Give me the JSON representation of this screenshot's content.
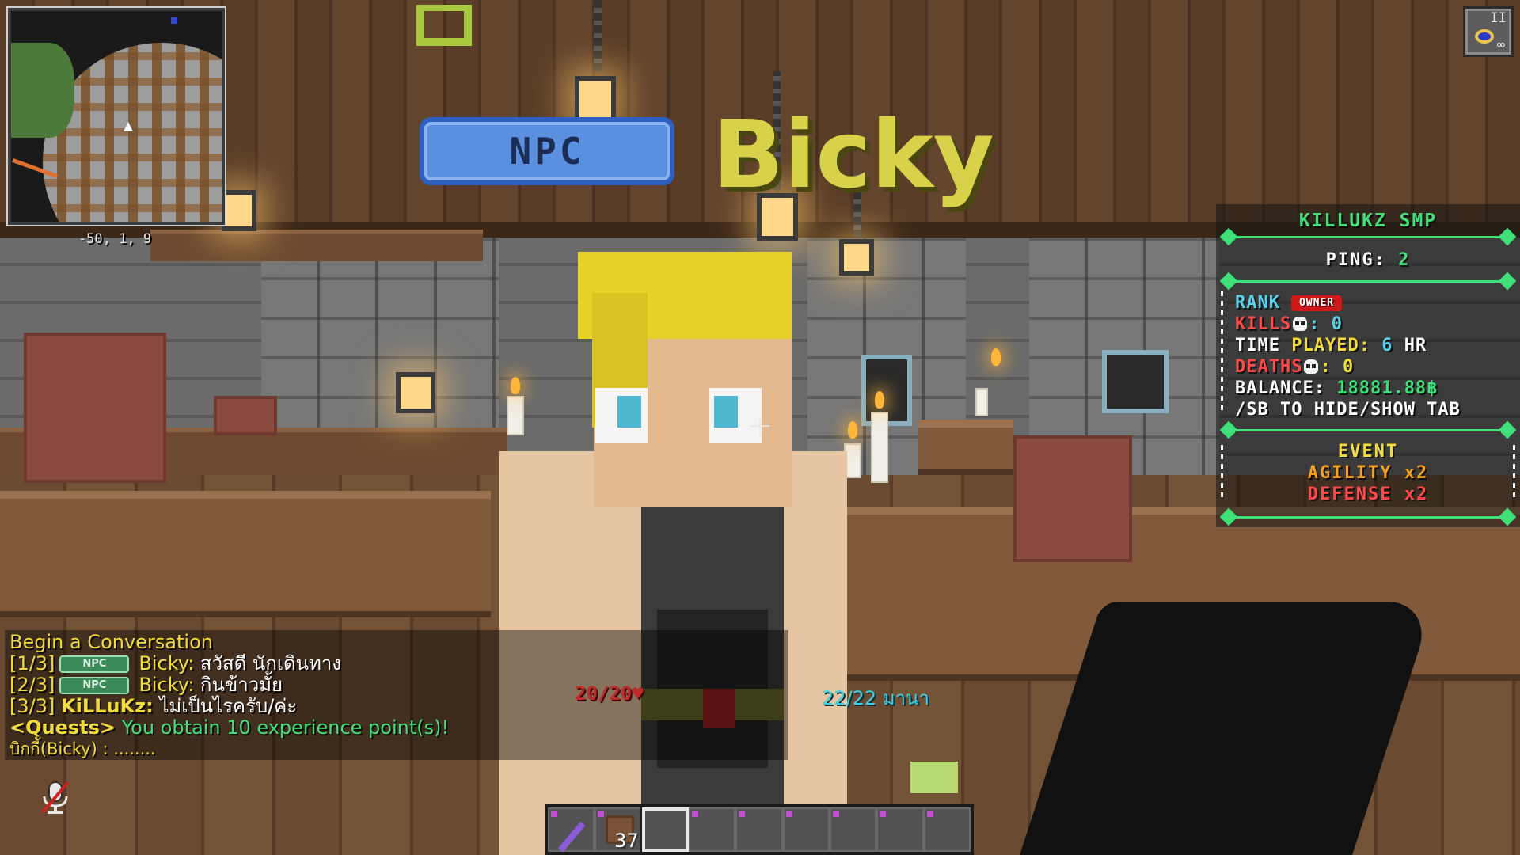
{
  "minimap": {
    "coordinates": "-50, 1, 9"
  },
  "npc_tag": {
    "badge": "NPC",
    "name": "Bicky"
  },
  "effect": {
    "level": "II",
    "duration": "∞"
  },
  "scoreboard": {
    "title": "KILLUKZ SMP",
    "ping_label": "PING:",
    "ping_value": "2",
    "rank_label": "RANK",
    "rank_value": "OWNER",
    "kills_label": "KILLS",
    "kills_value": ": 0",
    "time_label_a": "TIME ",
    "time_label_b": "PLAYED:",
    "time_value": "6",
    "time_unit": "HR",
    "deaths_label": "DEATHS",
    "deaths_value": ": 0",
    "balance_label": "BALANCE:",
    "balance_value": "18881.88฿",
    "hint": "/SB TO HIDE/SHOW TAB",
    "event_label": "EVENT",
    "event_agility": "AGILITY x2",
    "event_defense": "DEFENSE x2"
  },
  "chat": {
    "lines": [
      {
        "prefix": "Begin a Conversation"
      },
      {
        "prefix": "[1/3]",
        "chip": "NPC",
        "speaker": "Bicky:",
        "text": "สวัสดี นักเดินทาง"
      },
      {
        "prefix": "[2/3]",
        "chip": "NPC",
        "speaker": "Bicky:",
        "text": "กินข้าวมั้ย"
      },
      {
        "prefix": "[3/3]",
        "speaker": "KiLLuKz:",
        "text": "ไม่เป็นไรครับ/ค่ะ"
      },
      {
        "prefix": "<Quests>",
        "text": "You obtain 10 experience point(s)!"
      },
      {
        "prefix": "บิกกี้(Bicky) : ........"
      }
    ]
  },
  "hud": {
    "health": "20/20♥",
    "mana": "22/22 มานา"
  },
  "hotbar": {
    "selected_index": 2,
    "slot1_count": "37"
  },
  "colors": {
    "scoreboard_accent": "#3fe07a",
    "npc_badge": "#5b8fe0",
    "npc_name": "#d8d24a",
    "health": "#c02a2a",
    "mana": "#3ad0e8"
  }
}
